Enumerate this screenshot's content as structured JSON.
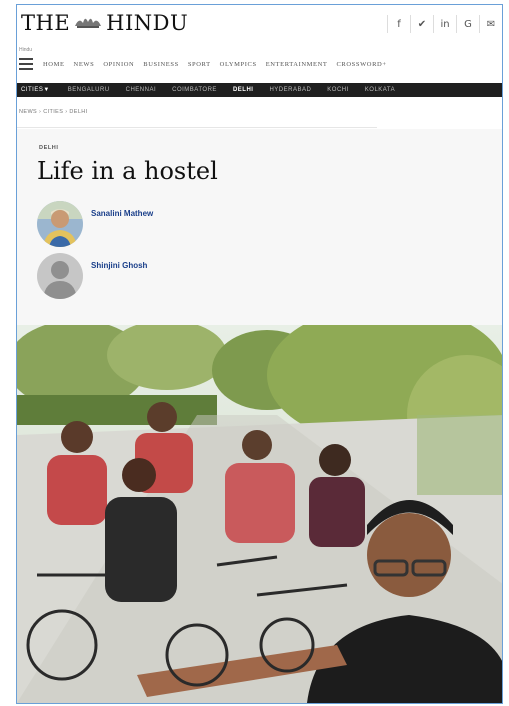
{
  "header": {
    "logo_left": "THE",
    "logo_right": "HINDU",
    "social": [
      "f",
      "✔",
      "in",
      "G",
      "✉"
    ]
  },
  "nav": {
    "small_label": "Hindu",
    "items": [
      "HOME",
      "NEWS",
      "OPINION",
      "BUSINESS",
      "SPORT",
      "OLYMPICS",
      "ENTERTAINMENT",
      "CROSSWORD+"
    ]
  },
  "cities": {
    "label": "CITIES▼",
    "items": [
      "BENGALURU",
      "CHENNAI",
      "COIMBATORE",
      "DELHI",
      "HYDERABAD",
      "KOCHI",
      "KOLKATA"
    ],
    "active": "DELHI"
  },
  "breadcrumb": "NEWS › CITIES › DELHI",
  "article": {
    "kicker": "DELHI",
    "title": "Life in a hostel",
    "authors": [
      "Sanalini Mathew",
      "Shinjini Ghosh"
    ]
  },
  "colors": {
    "frame_border": "#6aa0d8",
    "author_link": "#1a3f8a",
    "city_bar": "#1f1f1f"
  }
}
